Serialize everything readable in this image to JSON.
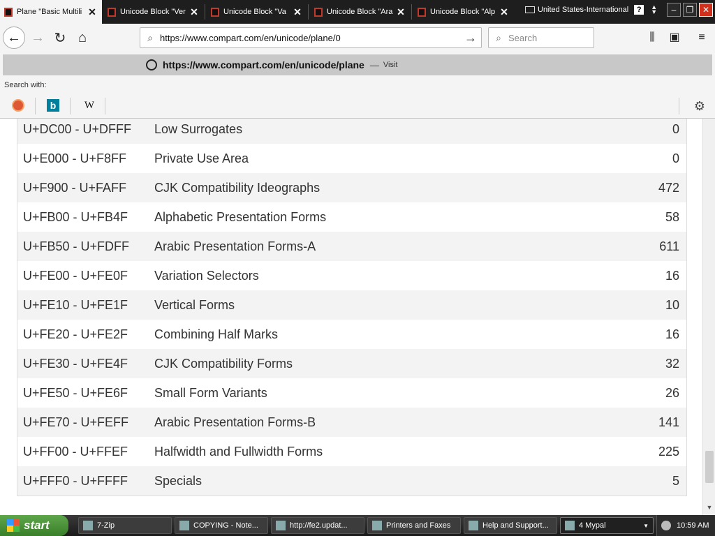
{
  "tabs": [
    {
      "label": "Plane \"Basic Multili",
      "active": true
    },
    {
      "label": "Unicode Block \"Ver",
      "active": false
    },
    {
      "label": "Unicode Block \"Va",
      "active": false
    },
    {
      "label": "Unicode Block \"Ara",
      "active": false
    },
    {
      "label": "Unicode Block \"Alp",
      "active": false
    }
  ],
  "language_bar": {
    "label": "United States-International",
    "help": "?"
  },
  "window": {
    "minimize": "–",
    "restore": "❐",
    "close": "✕"
  },
  "nav": {
    "back": "←",
    "forward": "→",
    "reload": "↻",
    "home": "⌂",
    "url": "https://www.compart.com/en/unicode/plane/0",
    "go": "→",
    "search_placeholder": "Search",
    "library": "⫼",
    "sidebar": "▣",
    "menu": "≡"
  },
  "dropdown": {
    "suggestion_url": "https://www.compart.com/en/unicode/plane",
    "dash": "—",
    "visit": "Visit",
    "search_with": "Search with:",
    "engines": [
      {
        "name": "duckduckgo",
        "glyph": ""
      },
      {
        "name": "bing",
        "glyph": "b"
      },
      {
        "name": "wikipedia",
        "glyph": "W"
      }
    ],
    "settings": "⚙"
  },
  "blocks": [
    {
      "range": "U+DC00 - U+DFFF",
      "name": "Low Surrogates",
      "count": "0"
    },
    {
      "range": "U+E000 - U+F8FF",
      "name": "Private Use Area",
      "count": "0"
    },
    {
      "range": "U+F900 - U+FAFF",
      "name": "CJK Compatibility Ideographs",
      "count": "472"
    },
    {
      "range": "U+FB00 - U+FB4F",
      "name": "Alphabetic Presentation Forms",
      "count": "58"
    },
    {
      "range": "U+FB50 - U+FDFF",
      "name": "Arabic Presentation Forms-A",
      "count": "611"
    },
    {
      "range": "U+FE00 - U+FE0F",
      "name": "Variation Selectors",
      "count": "16"
    },
    {
      "range": "U+FE10 - U+FE1F",
      "name": "Vertical Forms",
      "count": "10"
    },
    {
      "range": "U+FE20 - U+FE2F",
      "name": "Combining Half Marks",
      "count": "16"
    },
    {
      "range": "U+FE30 - U+FE4F",
      "name": "CJK Compatibility Forms",
      "count": "32"
    },
    {
      "range": "U+FE50 - U+FE6F",
      "name": "Small Form Variants",
      "count": "26"
    },
    {
      "range": "U+FE70 - U+FEFF",
      "name": "Arabic Presentation Forms-B",
      "count": "141"
    },
    {
      "range": "U+FF00 - U+FFEF",
      "name": "Halfwidth and Fullwidth Forms",
      "count": "225"
    },
    {
      "range": "U+FFF0 - U+FFFF",
      "name": "Specials",
      "count": "5"
    }
  ],
  "taskbar": {
    "start": "start",
    "tasks": [
      {
        "label": "7-Zip",
        "active": false
      },
      {
        "label": "COPYING - Note...",
        "active": false
      },
      {
        "label": "http://fe2.updat...",
        "active": false
      },
      {
        "label": "Printers and Faxes",
        "active": false
      },
      {
        "label": "Help and Support...",
        "active": false
      },
      {
        "label": "4 Mypal",
        "active": true
      }
    ],
    "clock": "10:59 AM"
  },
  "colors": {
    "tab_bg": "#1e1e1e",
    "toolbar_bg": "#f4f4f4",
    "row_alt": "#f3f3f3",
    "text": "#333333",
    "start_green": "#3a7f2a"
  }
}
